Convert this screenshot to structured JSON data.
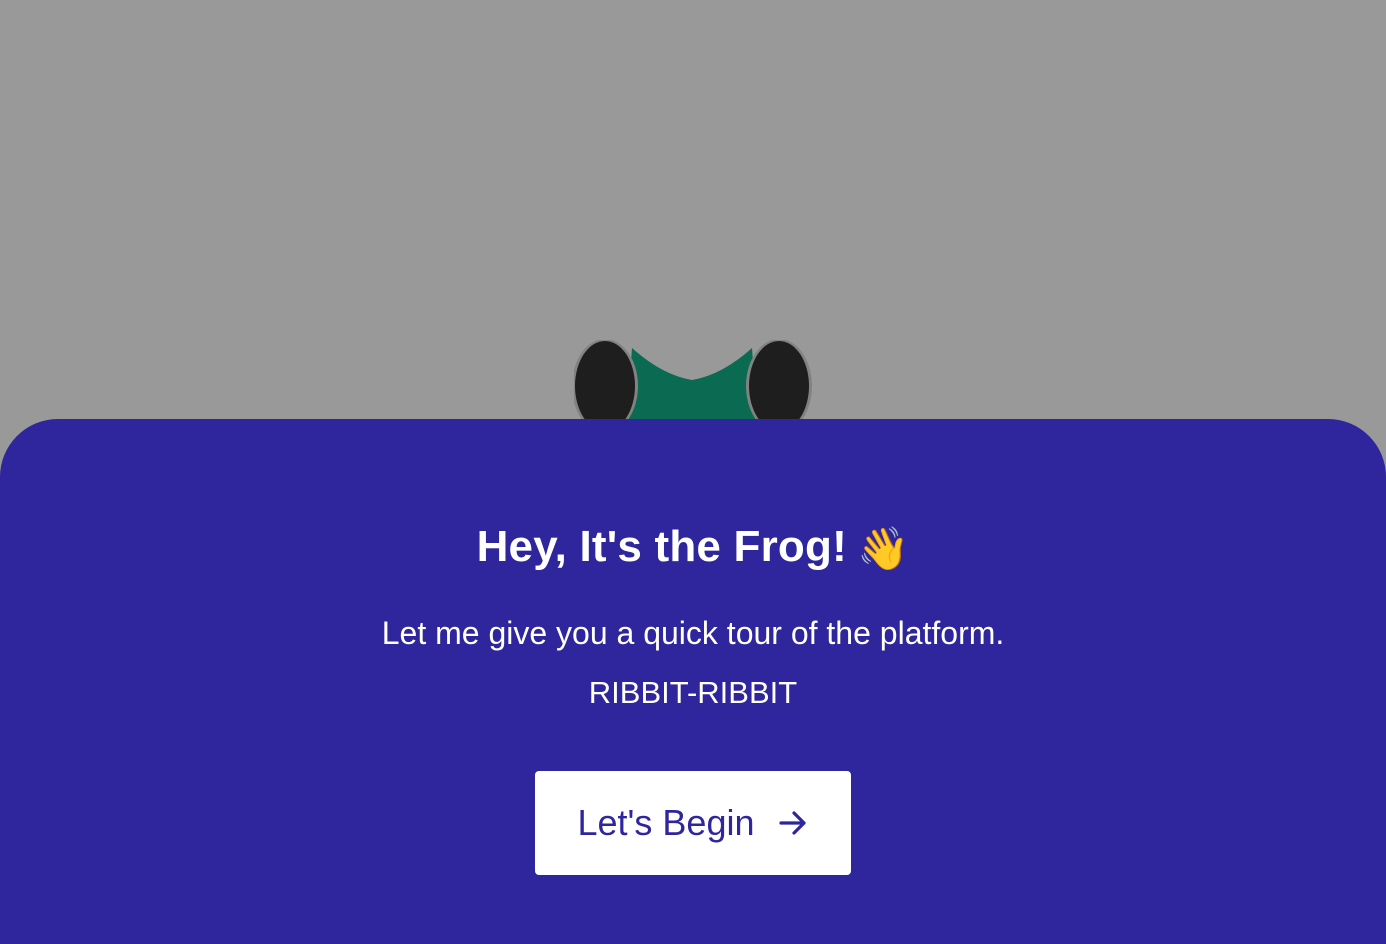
{
  "dialog": {
    "title": "Hey, It's the Frog!",
    "title_emoji": "👋",
    "message": "Let me give you a quick tour of the platform.",
    "tagline": "RIBBIT-RIBBIT",
    "begin_label": "Let's Begin",
    "begin_icon": "arrow-right-icon"
  },
  "mascot": {
    "icon": "frog-icon",
    "eye_color": "#1e1e1e",
    "head_color": "#0b6b52"
  },
  "colors": {
    "overlay": "#999999",
    "panel": "#2f269d",
    "button_bg": "#ffffff",
    "button_text": "#2f269d"
  }
}
